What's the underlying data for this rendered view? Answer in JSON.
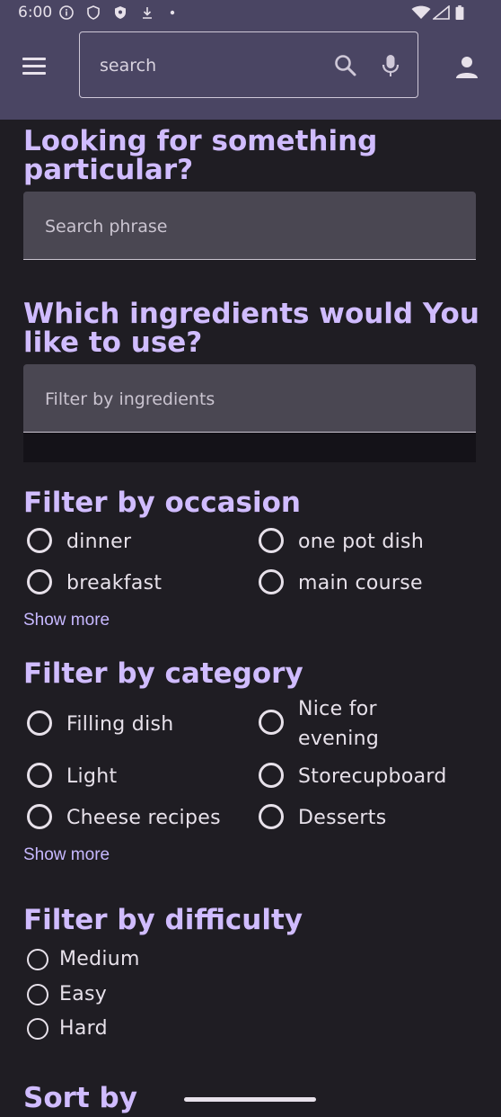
{
  "status_bar": {
    "time": "6:00"
  },
  "app_bar": {
    "search_placeholder": "search"
  },
  "sections": {
    "search": {
      "heading_line1": "Looking for something",
      "heading_line2": "particular?",
      "placeholder": "Search phrase"
    },
    "ingredients": {
      "heading_line1": "Which ingredients would You",
      "heading_line2": "like to use?",
      "placeholder": "Filter by ingredients"
    },
    "occasion": {
      "heading": "Filter by occasion",
      "options": [
        "dinner",
        "one pot dish",
        "breakfast",
        "main course"
      ],
      "show_more": "Show more"
    },
    "category": {
      "heading": "Filter by category",
      "options": [
        "Filling dish",
        "Nice for",
        "evening",
        "Light",
        "Storecupboard",
        "Cheese recipes",
        "Desserts"
      ],
      "show_more": "Show more"
    },
    "difficulty": {
      "heading": "Filter by difficulty",
      "options": [
        "Medium",
        "Easy",
        "Hard"
      ]
    },
    "sort": {
      "heading": "Sort by"
    }
  },
  "colors": {
    "app_bar": "#4a4563",
    "background": "#1f1d23",
    "accent": "#d0bcff",
    "field": "#4a4752"
  }
}
